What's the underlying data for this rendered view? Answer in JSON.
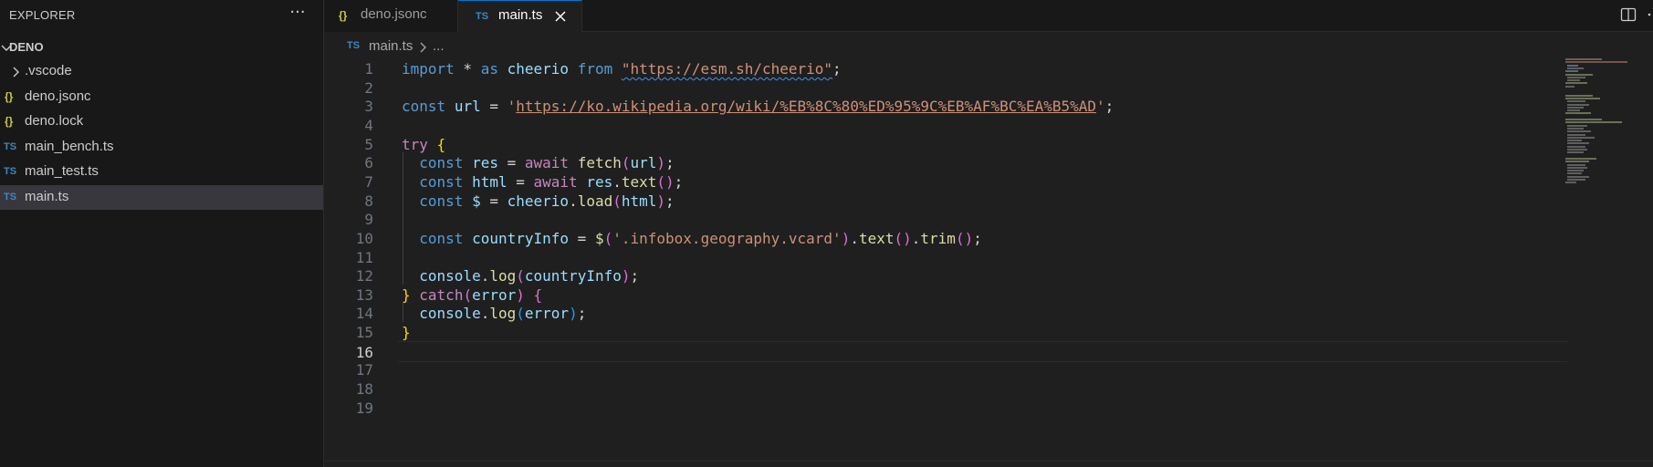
{
  "sidebar": {
    "title": "EXPLORER",
    "more_glyph": "···",
    "section_label": "DENO",
    "items": [
      {
        "label": ".vscode",
        "icon": "chevron-right-icon",
        "icon_text": "",
        "kind": "folder"
      },
      {
        "label": "deno.jsonc",
        "icon": "json-icon",
        "icon_text": "{}",
        "kind": "json"
      },
      {
        "label": "deno.lock",
        "icon": "json-icon",
        "icon_text": "{}",
        "kind": "json"
      },
      {
        "label": "main_bench.ts",
        "icon": "typescript-icon",
        "icon_text": "TS",
        "kind": "ts"
      },
      {
        "label": "main_test.ts",
        "icon": "typescript-icon",
        "icon_text": "TS",
        "kind": "ts"
      },
      {
        "label": "main.ts",
        "icon": "typescript-icon",
        "icon_text": "TS",
        "kind": "ts",
        "selected": true
      }
    ]
  },
  "tabs": [
    {
      "label": "deno.jsonc",
      "icon_text": "{}",
      "active": false
    },
    {
      "label": "main.ts",
      "icon_text": "TS",
      "active": true
    }
  ],
  "breadcrumb": {
    "icon_text": "TS",
    "file": "main.ts",
    "more": "..."
  },
  "editor": {
    "current_line": 16,
    "line_numbers": [
      "1",
      "2",
      "3",
      "4",
      "5",
      "6",
      "7",
      "8",
      "9",
      "10",
      "11",
      "12",
      "13",
      "14",
      "15",
      "16",
      "17",
      "18",
      "19"
    ],
    "lines": [
      [
        [
          "k",
          "import"
        ],
        [
          "p",
          " * "
        ],
        [
          "k",
          "as"
        ],
        [
          "p",
          " "
        ],
        [
          "v",
          "cheerio"
        ],
        [
          "p",
          " "
        ],
        [
          "k",
          "from"
        ],
        [
          "p",
          " "
        ],
        [
          "s squiggle",
          "\"https://esm.sh/cheerio\""
        ],
        [
          "p",
          ";"
        ]
      ],
      [],
      [
        [
          "k",
          "const"
        ],
        [
          "p",
          " "
        ],
        [
          "v",
          "url"
        ],
        [
          "p",
          " = "
        ],
        [
          "s",
          "'"
        ],
        [
          "s url",
          "https://ko.wikipedia.org/wiki/%EB%8C%80%ED%95%9C%EB%AF%BC%EA%B5%AD"
        ],
        [
          "s",
          "'"
        ],
        [
          "p",
          ";"
        ]
      ],
      [],
      [
        [
          "kc",
          "try"
        ],
        [
          "p",
          " "
        ],
        [
          "b1",
          "{"
        ]
      ],
      [
        [
          "p",
          "  "
        ],
        [
          "k",
          "const"
        ],
        [
          "p",
          " "
        ],
        [
          "v",
          "res"
        ],
        [
          "p",
          " = "
        ],
        [
          "kc",
          "await"
        ],
        [
          "p",
          " "
        ],
        [
          "f",
          "fetch"
        ],
        [
          "b2",
          "("
        ],
        [
          "v",
          "url"
        ],
        [
          "b2",
          ")"
        ],
        [
          "p",
          ";"
        ]
      ],
      [
        [
          "p",
          "  "
        ],
        [
          "k",
          "const"
        ],
        [
          "p",
          " "
        ],
        [
          "v",
          "html"
        ],
        [
          "p",
          " = "
        ],
        [
          "kc",
          "await"
        ],
        [
          "p",
          " "
        ],
        [
          "v",
          "res"
        ],
        [
          "p",
          "."
        ],
        [
          "f",
          "text"
        ],
        [
          "b2",
          "()"
        ],
        [
          "p",
          ";"
        ]
      ],
      [
        [
          "p",
          "  "
        ],
        [
          "k",
          "const"
        ],
        [
          "p",
          " "
        ],
        [
          "v",
          "$"
        ],
        [
          "p",
          " = "
        ],
        [
          "v",
          "cheerio"
        ],
        [
          "p",
          "."
        ],
        [
          "f",
          "load"
        ],
        [
          "b2",
          "("
        ],
        [
          "v",
          "html"
        ],
        [
          "b2",
          ")"
        ],
        [
          "p",
          ";"
        ]
      ],
      [],
      [
        [
          "p",
          "  "
        ],
        [
          "k",
          "const"
        ],
        [
          "p",
          " "
        ],
        [
          "v",
          "countryInfo"
        ],
        [
          "p",
          " = "
        ],
        [
          "f",
          "$"
        ],
        [
          "b2",
          "("
        ],
        [
          "s",
          "'.infobox.geography.vcard'"
        ],
        [
          "b2",
          ")"
        ],
        [
          "p",
          "."
        ],
        [
          "f",
          "text"
        ],
        [
          "b2",
          "()"
        ],
        [
          "p",
          "."
        ],
        [
          "f",
          "trim"
        ],
        [
          "b2",
          "()"
        ],
        [
          "p",
          ";"
        ]
      ],
      [],
      [
        [
          "p",
          "  "
        ],
        [
          "v",
          "console"
        ],
        [
          "p",
          "."
        ],
        [
          "f",
          "log"
        ],
        [
          "b2",
          "("
        ],
        [
          "v",
          "countryInfo"
        ],
        [
          "b2",
          ")"
        ],
        [
          "p",
          ";"
        ]
      ],
      [
        [
          "b1",
          "}"
        ],
        [
          "p",
          " "
        ],
        [
          "kc",
          "catch"
        ],
        [
          "b2",
          "("
        ],
        [
          "v",
          "error"
        ],
        [
          "b2",
          ")"
        ],
        [
          "p",
          " "
        ],
        [
          "b2",
          "{"
        ]
      ],
      [
        [
          "p",
          "  "
        ],
        [
          "v",
          "console"
        ],
        [
          "p",
          "."
        ],
        [
          "f",
          "log"
        ],
        [
          "b3",
          "("
        ],
        [
          "v",
          "error"
        ],
        [
          "b3",
          ")"
        ],
        [
          "p",
          ";"
        ]
      ],
      [
        [
          "b1",
          "}"
        ]
      ],
      [],
      [],
      [],
      []
    ]
  },
  "colors": {
    "accent": "#0078d4",
    "ts_icon": "#3e86c6",
    "json_icon": "#cbcb41"
  }
}
